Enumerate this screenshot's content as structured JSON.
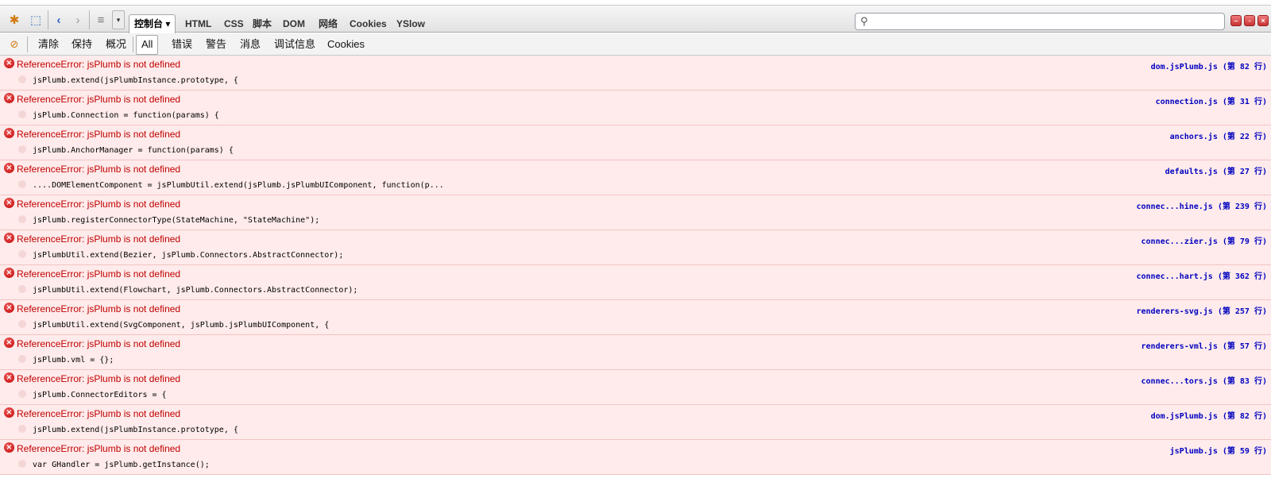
{
  "toolbar": {
    "icons": [
      "firebug-icon",
      "inspect-icon",
      "back-icon",
      "forward-icon",
      "menu-icon",
      "dropdown-icon"
    ],
    "tabs": [
      {
        "label": "控制台 ▾",
        "active": true
      },
      {
        "label": "HTML",
        "active": false
      },
      {
        "label": "CSS",
        "active": false
      },
      {
        "label": "脚本",
        "active": false
      },
      {
        "label": "DOM",
        "active": false
      },
      {
        "label": "网络",
        "active": false
      },
      {
        "label": "Cookies",
        "active": false
      },
      {
        "label": "YSlow",
        "active": false
      }
    ],
    "search": {
      "value": "",
      "placeholder": ""
    },
    "window_buttons": [
      "minimize-icon",
      "detach-icon",
      "close-icon"
    ]
  },
  "filterbar": {
    "actions": [
      "清除",
      "保持",
      "概况"
    ],
    "filters": [
      {
        "label": "All",
        "active": true
      },
      {
        "label": "错误",
        "active": false
      },
      {
        "label": "警告",
        "active": false
      },
      {
        "label": "消息",
        "active": false
      },
      {
        "label": "调试信息",
        "active": false
      },
      {
        "label": "Cookies",
        "active": false
      }
    ]
  },
  "colors": {
    "error_text": "#c00000",
    "row_background": "#ffebeb",
    "location_link": "#0000c0"
  },
  "log": [
    {
      "message": "ReferenceError: jsPlumb is not defined",
      "source": "jsPlumb.extend(jsPlumbInstance.prototype, {",
      "location": "dom.jsPlumb.js (第 82 行)"
    },
    {
      "message": "ReferenceError: jsPlumb is not defined",
      "source": "jsPlumb.Connection = function(params) {",
      "location": "connection.js (第 31 行)"
    },
    {
      "message": "ReferenceError: jsPlumb is not defined",
      "source": "jsPlumb.AnchorManager = function(params) {",
      "location": "anchors.js (第 22 行)"
    },
    {
      "message": "ReferenceError: jsPlumb is not defined",
      "source": "....DOMElementComponent = jsPlumbUtil.extend(jsPlumb.jsPlumbUIComponent, function(p...",
      "location": "defaults.js (第 27 行)"
    },
    {
      "message": "ReferenceError: jsPlumb is not defined",
      "source": "jsPlumb.registerConnectorType(StateMachine, \"StateMachine\");",
      "location": "connec...hine.js (第 239 行)"
    },
    {
      "message": "ReferenceError: jsPlumb is not defined",
      "source": "jsPlumbUtil.extend(Bezier, jsPlumb.Connectors.AbstractConnector);",
      "location": "connec...zier.js (第 79 行)"
    },
    {
      "message": "ReferenceError: jsPlumb is not defined",
      "source": "jsPlumbUtil.extend(Flowchart, jsPlumb.Connectors.AbstractConnector);",
      "location": "connec...hart.js (第 362 行)"
    },
    {
      "message": "ReferenceError: jsPlumb is not defined",
      "source": "jsPlumbUtil.extend(SvgComponent, jsPlumb.jsPlumbUIComponent, {",
      "location": "renderers-svg.js (第 257 行)"
    },
    {
      "message": "ReferenceError: jsPlumb is not defined",
      "source": "jsPlumb.vml = {};",
      "location": "renderers-vml.js (第 57 行)"
    },
    {
      "message": "ReferenceError: jsPlumb is not defined",
      "source": "jsPlumb.ConnectorEditors = {",
      "location": "connec...tors.js (第 83 行)"
    },
    {
      "message": "ReferenceError: jsPlumb is not defined",
      "source": "jsPlumb.extend(jsPlumbInstance.prototype, {",
      "location": "dom.jsPlumb.js (第 82 行)"
    },
    {
      "message": "ReferenceError: jsPlumb is not defined",
      "source": "var GHandler = jsPlumb.getInstance();",
      "location": "jsPlumb.js (第 59 行)"
    }
  ]
}
